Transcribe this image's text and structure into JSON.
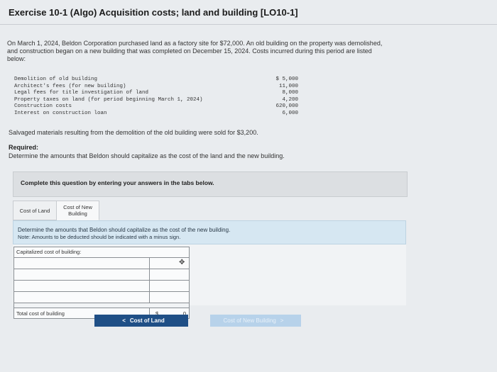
{
  "header": {
    "title": "Exercise 10-1 (Algo) Acquisition costs; land and building [LO10-1]"
  },
  "problem": {
    "intro_line1": "On March 1, 2024, Beldon Corporation purchased land as a factory site for $72,000. An old building on the property was demolished,",
    "intro_line2": "and construction began on a new building that was completed on December 15, 2024. Costs incurred during this period are listed",
    "intro_line3": "below:",
    "costs": [
      {
        "label": "Demolition of old building",
        "value": "$ 5,000"
      },
      {
        "label": "Architect's fees (for new building)",
        "value": "11,000"
      },
      {
        "label": "Legal fees for title investigation of land",
        "value": "8,000"
      },
      {
        "label": "Property taxes on land (for period beginning March 1, 2024)",
        "value": "4,200"
      },
      {
        "label": "Construction costs",
        "value": "620,000"
      },
      {
        "label": "Interest on construction loan",
        "value": "6,000"
      }
    ],
    "salvage": "Salvaged materials resulting from the demolition of the old building were sold for $3,200.",
    "required_heading": "Required:",
    "required_text": "Determine the amounts that Beldon should capitalize as the cost of the land and the new building."
  },
  "instructions": "Complete this question by entering your answers in the tabs below.",
  "tabs": {
    "land": "Cost of Land",
    "building": "Cost of New Building"
  },
  "panel": {
    "line1": "Determine the amounts that Beldon should capitalize as the cost of the new building.",
    "line2": "Note: Amounts to be deducted should be indicated with a minus sign."
  },
  "table": {
    "header": "Capitalized cost of building:",
    "total_label": "Total cost of building",
    "currency": "$",
    "total_value": "0"
  },
  "nav": {
    "prev_label": "Cost of Land",
    "next_label": "Cost of New Building",
    "prev_chevron": "<",
    "next_chevron": ">"
  }
}
